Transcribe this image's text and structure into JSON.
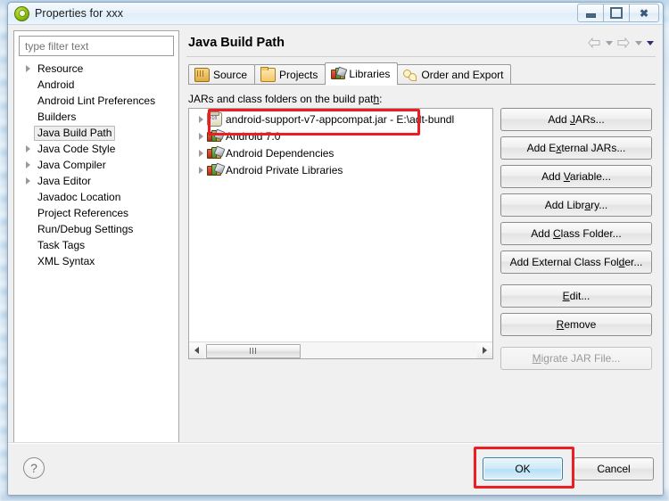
{
  "window": {
    "title": "Properties for xxx",
    "icon": "properties-circle-icon",
    "minimize_label": "Minimize",
    "maximize_label": "Maximize",
    "close_label": "Close"
  },
  "filter": {
    "placeholder": "type filter text",
    "value": ""
  },
  "sidebar": {
    "items": [
      {
        "label": "Resource",
        "expandable": true,
        "selected": false
      },
      {
        "label": "Android",
        "expandable": false,
        "selected": false
      },
      {
        "label": "Android Lint Preferences",
        "expandable": false,
        "selected": false
      },
      {
        "label": "Builders",
        "expandable": false,
        "selected": false
      },
      {
        "label": "Java Build Path",
        "expandable": false,
        "selected": true
      },
      {
        "label": "Java Code Style",
        "expandable": true,
        "selected": false
      },
      {
        "label": "Java Compiler",
        "expandable": true,
        "selected": false
      },
      {
        "label": "Java Editor",
        "expandable": true,
        "selected": false
      },
      {
        "label": "Javadoc Location",
        "expandable": false,
        "selected": false
      },
      {
        "label": "Project References",
        "expandable": false,
        "selected": false
      },
      {
        "label": "Run/Debug Settings",
        "expandable": false,
        "selected": false
      },
      {
        "label": "Task Tags",
        "expandable": false,
        "selected": false
      },
      {
        "label": "XML Syntax",
        "expandable": false,
        "selected": false
      }
    ]
  },
  "page": {
    "title": "Java Build Path",
    "nav": {
      "back_icon": "back-arrow-icon",
      "back_menu_icon": "chevron-down-icon",
      "forward_icon": "forward-arrow-icon",
      "forward_menu_icon": "chevron-down-icon",
      "view_menu_icon": "chevron-down-icon"
    }
  },
  "tabs": [
    {
      "label": "Source",
      "icon": "source-folder-icon",
      "active": false
    },
    {
      "label": "Projects",
      "icon": "open-folder-icon",
      "active": false
    },
    {
      "label": "Libraries",
      "icon": "libraries-books-icon",
      "active": true
    },
    {
      "label": "Order and Export",
      "icon": "order-export-icon",
      "active": false
    }
  ],
  "libraries": {
    "label_pre": "JARs and class folders on the build pat",
    "label_mnemonic": "h",
    "label_post": ":",
    "entries": [
      {
        "name": "android-support-v7-appcompat.jar - E:\\adt-bundl",
        "icon": "jar-icon",
        "highlighted": true
      },
      {
        "name": "Android 7.0",
        "icon": "library-icon",
        "highlighted": false
      },
      {
        "name": "Android Dependencies",
        "icon": "library-icon",
        "highlighted": false
      },
      {
        "name": "Android Private Libraries",
        "icon": "library-icon",
        "highlighted": false
      }
    ]
  },
  "buttons": [
    {
      "pre": "Add ",
      "mnemonic": "J",
      "post": "ARs...",
      "disabled": false,
      "gap": false
    },
    {
      "pre": "Add E",
      "mnemonic": "x",
      "post": "ternal JARs...",
      "disabled": false,
      "gap": false
    },
    {
      "pre": "Add ",
      "mnemonic": "V",
      "post": "ariable...",
      "disabled": false,
      "gap": false
    },
    {
      "pre": "Add Libr",
      "mnemonic": "a",
      "post": "ry...",
      "disabled": false,
      "gap": false
    },
    {
      "pre": "Add ",
      "mnemonic": "C",
      "post": "lass Folder...",
      "disabled": false,
      "gap": false
    },
    {
      "pre": "Add External Class Fol",
      "mnemonic": "d",
      "post": "er...",
      "disabled": false,
      "gap": false
    },
    {
      "pre": "",
      "mnemonic": "E",
      "post": "dit...",
      "disabled": false,
      "gap": true
    },
    {
      "pre": "",
      "mnemonic": "R",
      "post": "emove",
      "disabled": false,
      "gap": false
    },
    {
      "pre": "",
      "mnemonic": "M",
      "post": "igrate JAR File...",
      "disabled": true,
      "gap": true
    }
  ],
  "footer": {
    "help_icon": "help-question-icon",
    "ok_label": "OK",
    "cancel_label": "Cancel"
  },
  "scrollbars": {
    "left_arrow_icon": "scroll-left-arrow-icon",
    "right_arrow_icon": "scroll-right-arrow-icon",
    "thumb_grip_icon": "scrollbar-grip-icon"
  },
  "annotations": {
    "highlight_color": "#ee1d23",
    "highlighted_items": [
      "android-support-v7-appcompat.jar",
      "OK"
    ]
  },
  "colors": {
    "dialog_bg": "#f0f0f0",
    "titlebar": "#e8f2fb",
    "list_bg": "#ffffff",
    "selection": "#eeeeee",
    "ok_accent": "#b4dff6"
  }
}
